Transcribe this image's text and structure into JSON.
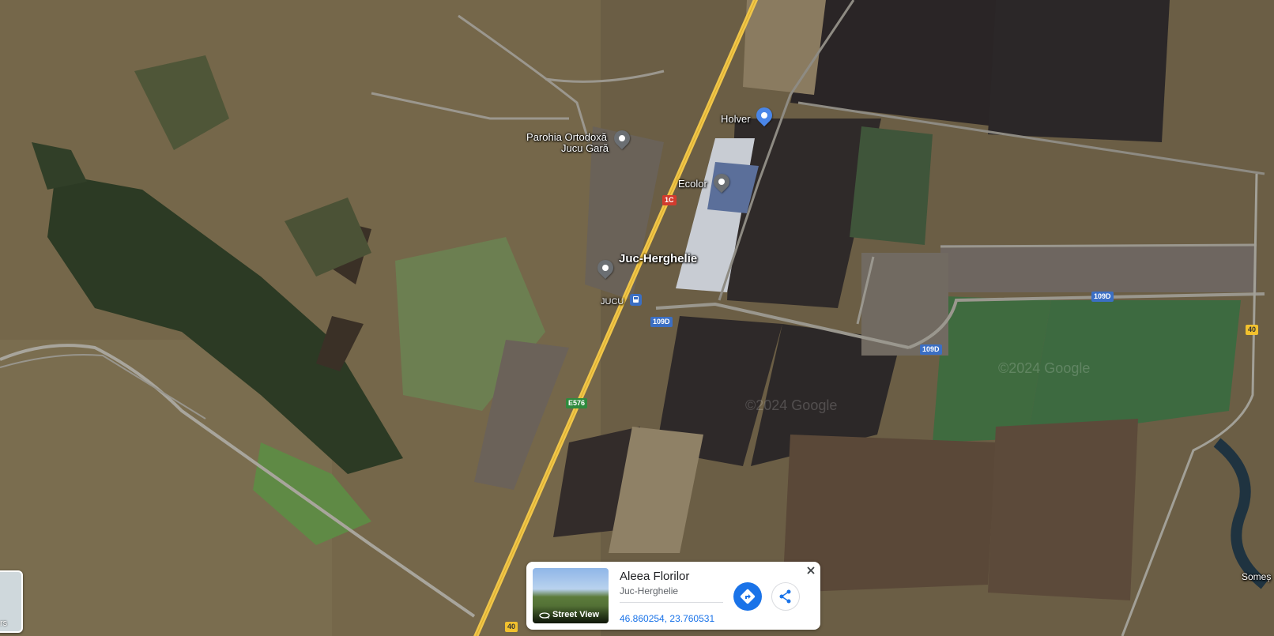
{
  "colors": {
    "accent": "#1a73e8",
    "pin_gray": "#6b6f73",
    "pin_blue": "#4a86e8",
    "transit_blue": "#3b6fc4",
    "road_yellow": "#f2c12e"
  },
  "map": {
    "places": {
      "juc_herghelie": "Juc-Herghelie",
      "parohia_line1": "Parohia Ortodoxă",
      "parohia_line2": "Jucu Gară",
      "holver": "Holver",
      "ecolor": "Ecolor",
      "jucu_station": "JUCU",
      "somes": "Someș"
    },
    "road_shields": {
      "road_1c": "1C",
      "e576": "E576",
      "road_109d_a": "109D",
      "road_109d_b": "109D",
      "road_109d_c": "109D",
      "road_40_a": "40",
      "road_40_b": "40"
    },
    "watermark": "©2024 Google",
    "icons": [
      "church-icon",
      "shopping-bag-icon",
      "location-pin-icon",
      "bus-icon"
    ]
  },
  "info_card": {
    "title": "Aleea Florilor",
    "subtitle": "Juc-Herghelie",
    "coordinates": "46.860254, 23.760531",
    "street_view_label": "Street View",
    "icons": [
      "directions-icon",
      "share-icon",
      "close-icon",
      "360-rotate-icon"
    ]
  },
  "layers_toggle": {
    "label": "rs"
  }
}
